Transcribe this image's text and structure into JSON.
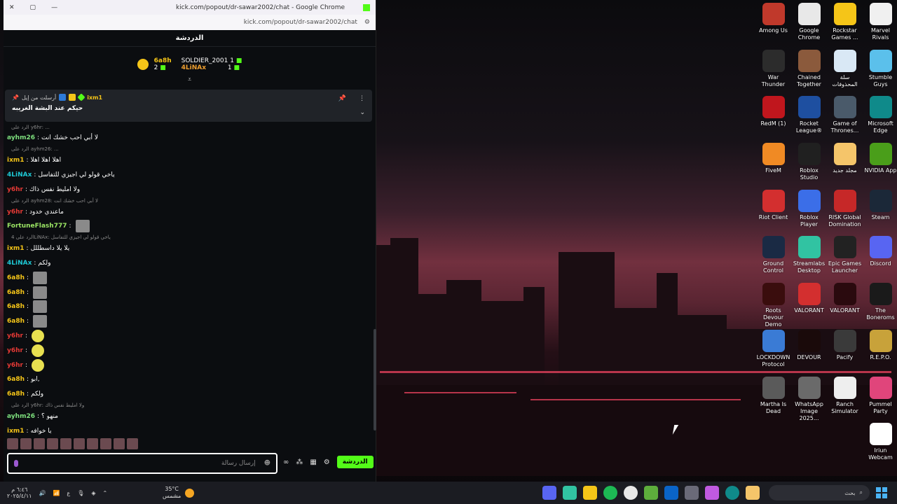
{
  "browser": {
    "title": "kick.com/popout/dr-sawar2002/chat - Google Chrome",
    "url": "kick.com/popout/dr-sawar2002/chat"
  },
  "chat": {
    "header": "الدردشة",
    "leaderboard": {
      "first_name": "6a8h",
      "first_count": "2",
      "second_name": "SOLDIER_2001",
      "second_count": "1",
      "third_name": "4LiNAx",
      "third_count": "1"
    },
    "pinned": {
      "user": "ixm1",
      "by": "أرسلت من إيل",
      "text": "حيكم عند البشة الغريبه"
    },
    "messages": [
      {
        "reply": "الرد على y6hr: ...",
        "user": "ayhm26",
        "color": "#7ee07e",
        "text": "لا أبي احب خشك انت"
      },
      {
        "reply": "الرد على ayhm26: ...",
        "user": "ixm1",
        "color": "#f5c518",
        "text": "اهلا اهلا اهلا"
      },
      {
        "user": "4LiNAx",
        "color": "#1ec8d4",
        "text": "ياخي قولو لي اجيزي للتفاسل"
      },
      {
        "user": "y6hr",
        "color": "#e53935",
        "text": "ولا امليط نفس ذاك"
      },
      {
        "reply": "الرد على ayhm28: لا أبي احب خشك انت",
        "user": "y6hr",
        "color": "#e53935",
        "text": "ماعندي خدود"
      },
      {
        "user": "FortuneFlash777",
        "color": "#9be564",
        "text": ""
      },
      {
        "reply": "الرد على 4LiNAx: ياخي قولو لي اجيزي للتفاسل",
        "user": "ixm1",
        "color": "#f5c518",
        "text": "يلا يلا داسطللل"
      },
      {
        "user": "4LiNAx",
        "color": "#1ec8d4",
        "text": "ولكم"
      },
      {
        "user": "6a8h",
        "color": "#f5c518",
        "text": ""
      },
      {
        "user": "6a8h",
        "color": "#f5c518",
        "text": ""
      },
      {
        "user": "6a8h",
        "color": "#f5c518",
        "text": ""
      },
      {
        "user": "6a8h",
        "color": "#f5c518",
        "text": ""
      },
      {
        "user": "y6hr",
        "color": "#e53935",
        "text": ""
      },
      {
        "user": "y6hr",
        "color": "#e53935",
        "text": ""
      },
      {
        "user": "y6hr",
        "color": "#e53935",
        "text": ""
      },
      {
        "user": "6a8h",
        "color": "#f5c518",
        "text": "ابو,"
      },
      {
        "user": "6a8h",
        "color": "#f5c518",
        "text": "ولكم"
      },
      {
        "reply": "الرد على y6hr: ولا امليط نفس ذاك",
        "user": "ayhm26",
        "color": "#7ee07e",
        "text": "منهو ؟"
      },
      {
        "user": "ixm1",
        "color": "#f5c518",
        "text": "يا خوافه"
      }
    ],
    "input_placeholder": "إرسال رسالة",
    "send_label": "الدردشة"
  },
  "desktop": [
    {
      "label": "Among Us",
      "color": "#c0392b"
    },
    {
      "label": "Google Chrome",
      "color": "#e8e8e8"
    },
    {
      "label": "Rockstar Games ...",
      "color": "#f5c518"
    },
    {
      "label": "Marvel Rivals",
      "color": "#f0f0f0"
    },
    {
      "label": "War Thunder",
      "color": "#2c2c2c"
    },
    {
      "label": "Chained Together",
      "color": "#8b5a3c"
    },
    {
      "label": "سلة المحذوفات",
      "color": "#d9e8f5"
    },
    {
      "label": "Stumble Guys",
      "color": "#5bc0eb"
    },
    {
      "label": "RedM (1)",
      "color": "#c0161d"
    },
    {
      "label": "Rocket League®",
      "color": "#1e4fa0"
    },
    {
      "label": "Game of Thrones...",
      "color": "#4a5a6a"
    },
    {
      "label": "Microsoft Edge",
      "color": "#0f8a8a"
    },
    {
      "label": "FiveM",
      "color": "#f08a24"
    },
    {
      "label": "Roblox Studio",
      "color": "#202020"
    },
    {
      "label": "مجلد جديد",
      "color": "#f5c56a"
    },
    {
      "label": "NVIDIA App",
      "color": "#4a9e1a"
    },
    {
      "label": "Riot Client",
      "color": "#d32f2f"
    },
    {
      "label": "Roblox Player",
      "color": "#3b6ee8"
    },
    {
      "label": "RISK Global Domination",
      "color": "#c62828"
    },
    {
      "label": "Steam",
      "color": "#1b2838"
    },
    {
      "label": "Ground Control",
      "color": "#1a2a44"
    },
    {
      "label": "Streamlabs Desktop",
      "color": "#31c3a2"
    },
    {
      "label": "Epic Games Launcher",
      "color": "#222222"
    },
    {
      "label": "Discord",
      "color": "#5865f2"
    },
    {
      "label": "Roots Devour Demo",
      "color": "#3a0d0d"
    },
    {
      "label": "VALORANT",
      "color": "#d32f2f"
    },
    {
      "label": "VALORANT",
      "color": "#2a0a0e"
    },
    {
      "label": "The Boneroms",
      "color": "#1a1a1a"
    },
    {
      "label": "LOCKDOWN Protocol",
      "color": "#3a7bd5"
    },
    {
      "label": "DEVOUR",
      "color": "#1a0a0a"
    },
    {
      "label": "Pacify",
      "color": "#3a3a3a"
    },
    {
      "label": "R.E.P.O.",
      "color": "#c8a23a"
    },
    {
      "label": "Martha Is Dead",
      "color": "#5a5a5a"
    },
    {
      "label": "WhatsApp Image 2025...",
      "color": "#6a6a6a"
    },
    {
      "label": "Ranch Simulator",
      "color": "#eeeeee"
    },
    {
      "label": "Pummel Party",
      "color": "#e0457b"
    },
    {
      "label": "",
      "color": "",
      "skip": true
    },
    {
      "label": "",
      "color": "",
      "skip": true
    },
    {
      "label": "",
      "color": "",
      "skip": true
    },
    {
      "label": "Iriun Webcam",
      "color": "#ffffff"
    }
  ],
  "taskbar": {
    "time": "٦:٤٦ م",
    "date": "٢٠٢٥/٤/١١",
    "lang": "ع",
    "temp": "35°C",
    "weather": "مشمس",
    "search_placeholder": "بحث"
  }
}
